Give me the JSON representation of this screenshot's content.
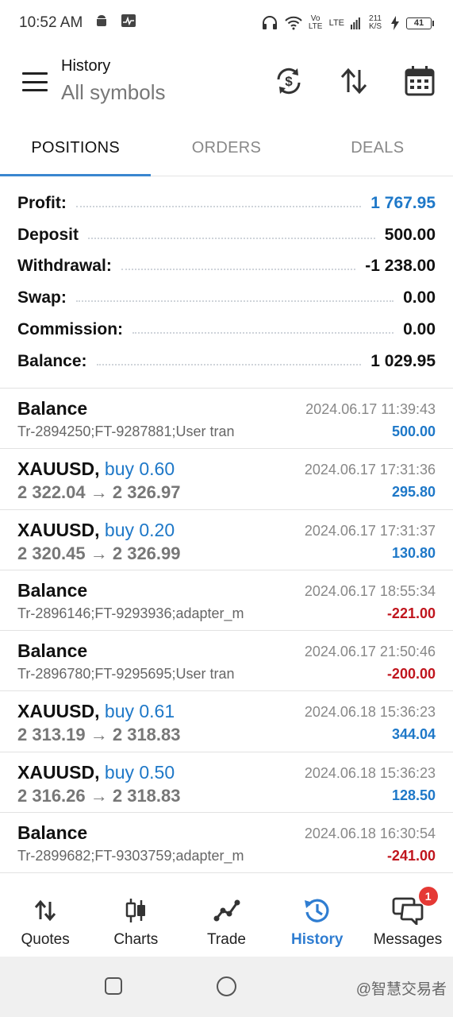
{
  "status_bar": {
    "time": "10:52 AM",
    "network_type": "LTE",
    "volte": "Vo LTE",
    "speed": "211 K/S",
    "battery": "41"
  },
  "header": {
    "title": "History",
    "subtitle": "All symbols"
  },
  "tabs": [
    {
      "label": "POSITIONS",
      "active": true
    },
    {
      "label": "ORDERS",
      "active": false
    },
    {
      "label": "DEALS",
      "active": false
    }
  ],
  "summary": [
    {
      "label": "Profit:",
      "value": "1 767.95",
      "highlight": true
    },
    {
      "label": "Deposit",
      "value": "500.00",
      "highlight": false
    },
    {
      "label": "Withdrawal:",
      "value": "-1 238.00",
      "highlight": false
    },
    {
      "label": "Swap:",
      "value": "0.00",
      "highlight": false
    },
    {
      "label": "Commission:",
      "value": "0.00",
      "highlight": false
    },
    {
      "label": "Balance:",
      "value": "1 029.95",
      "highlight": false
    }
  ],
  "records": [
    {
      "type": "balance",
      "title": "Balance",
      "detail": "Tr-2894250;FT-9287881;User tran",
      "time": "2024.06.17 11:39:43",
      "amount": "500.00",
      "sign": "pos"
    },
    {
      "type": "trade",
      "symbol": "XAUUSD,",
      "side": "buy 0.60",
      "prices": "2 322.04 → 2 326.97",
      "time": "2024.06.17 17:31:36",
      "amount": "295.80",
      "sign": "pos"
    },
    {
      "type": "trade",
      "symbol": "XAUUSD,",
      "side": "buy 0.20",
      "prices": "2 320.45 → 2 326.99",
      "time": "2024.06.17 17:31:37",
      "amount": "130.80",
      "sign": "pos"
    },
    {
      "type": "balance",
      "title": "Balance",
      "detail": "Tr-2896146;FT-9293936;adapter_m",
      "time": "2024.06.17 18:55:34",
      "amount": "-221.00",
      "sign": "neg"
    },
    {
      "type": "balance",
      "title": "Balance",
      "detail": "Tr-2896780;FT-9295695;User tran",
      "time": "2024.06.17 21:50:46",
      "amount": "-200.00",
      "sign": "neg"
    },
    {
      "type": "trade",
      "symbol": "XAUUSD,",
      "side": "buy 0.61",
      "prices": "2 313.19 → 2 318.83",
      "time": "2024.06.18 15:36:23",
      "amount": "344.04",
      "sign": "pos"
    },
    {
      "type": "trade",
      "symbol": "XAUUSD,",
      "side": "buy 0.50",
      "prices": "2 316.26 → 2 318.83",
      "time": "2024.06.18 15:36:23",
      "amount": "128.50",
      "sign": "pos"
    },
    {
      "type": "balance",
      "title": "Balance",
      "detail": "Tr-2899682;FT-9303759;adapter_m",
      "time": "2024.06.18 16:30:54",
      "amount": "-241.00",
      "sign": "neg"
    }
  ],
  "bottom_nav": [
    {
      "label": "Quotes",
      "icon": "quotes-icon",
      "active": false
    },
    {
      "label": "Charts",
      "icon": "charts-icon",
      "active": false
    },
    {
      "label": "Trade",
      "icon": "trade-icon",
      "active": false
    },
    {
      "label": "History",
      "icon": "history-icon",
      "active": true
    },
    {
      "label": "Messages",
      "icon": "messages-icon",
      "active": false,
      "badge": "1"
    }
  ],
  "watermark": "@智慧交易者",
  "colors": {
    "accent": "#2f7dd1",
    "profit": "#1e78c8",
    "loss": "#c0151d"
  }
}
